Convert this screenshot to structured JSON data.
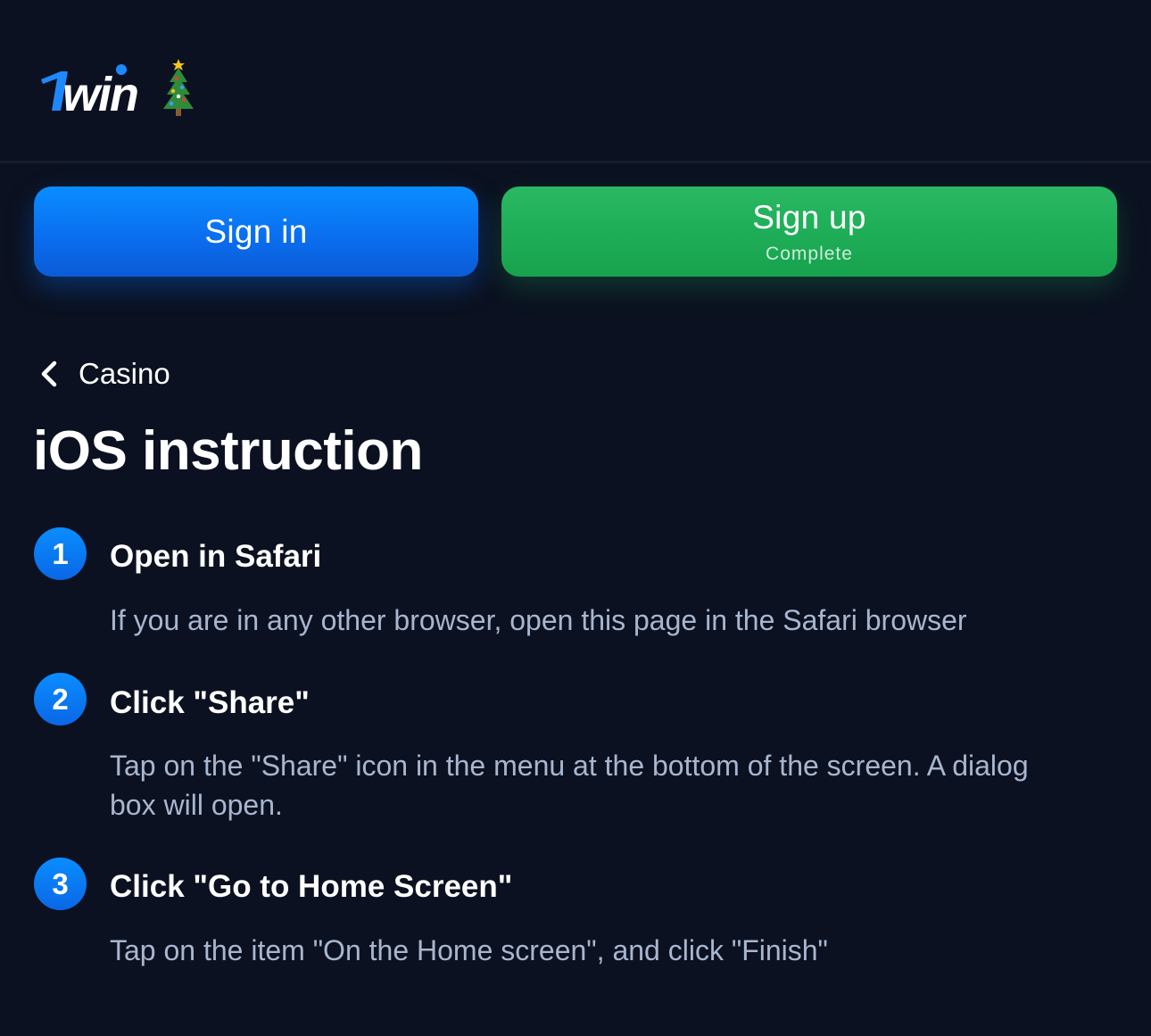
{
  "brand": {
    "name": "1win",
    "icon": "christmas-tree-icon",
    "color": "#ffffff",
    "accent": "#0a8dff"
  },
  "auth": {
    "signin_label": "Sign in",
    "signup_label": "Sign up",
    "signup_sublabel": "Complete",
    "signin_color": "#0a7af5",
    "signup_color": "#1fae58"
  },
  "nav": {
    "back_icon": "chevron-left-icon",
    "back_label": "Casino"
  },
  "page": {
    "title": "iOS instruction"
  },
  "steps": [
    {
      "number": "1",
      "title": "Open in Safari",
      "description": "If you are in any other browser, open this page in the Safari browser"
    },
    {
      "number": "2",
      "title": "Click \"Share\"",
      "description": "Tap on the \"Share\" icon in the menu at the bottom of the screen. A dialog box will open."
    },
    {
      "number": "3",
      "title": "Click \"Go to Home Screen\"",
      "description": "Tap on the item \"On the Home screen\", and click \"Finish\""
    }
  ]
}
